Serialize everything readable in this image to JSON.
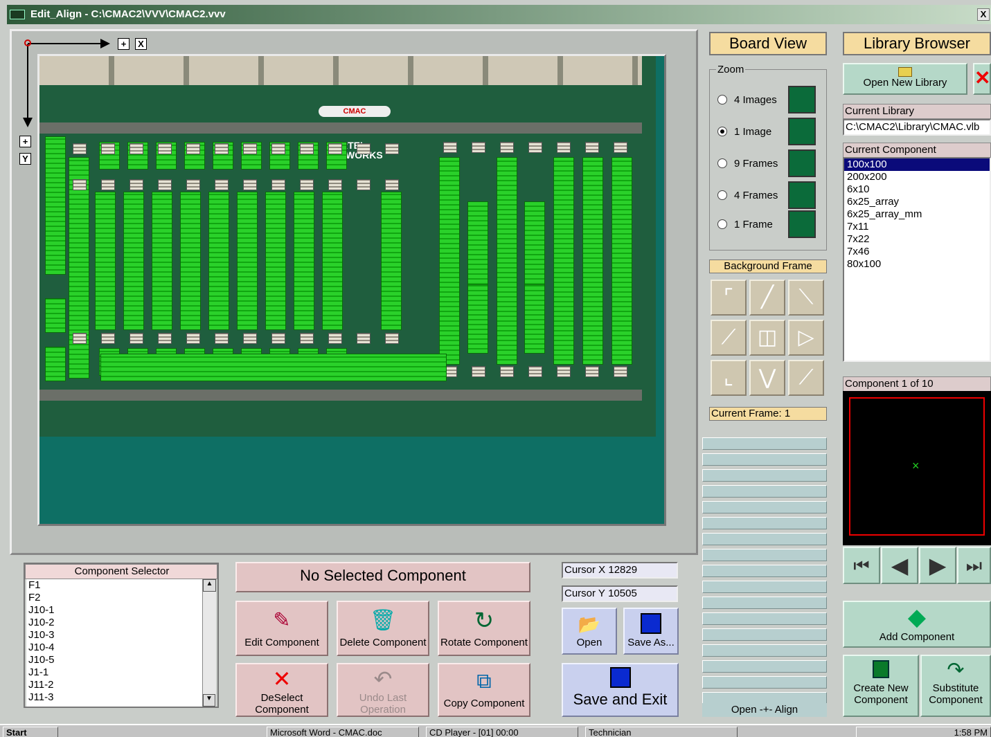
{
  "window": {
    "title": "Edit_Align - C:\\CMAC2\\VVV\\CMAC2.vvv",
    "close_label": "X"
  },
  "canvas": {
    "x_axis_label": "X",
    "y_axis_label": "Y",
    "plus": "+",
    "board_brand": "NORTEL NETWORKS",
    "board_logo": "CMAC"
  },
  "board_view": {
    "title": "Board View",
    "zoom_label": "Zoom",
    "options": [
      "4 Images",
      "1 Image",
      "9 Frames",
      "4 Frames",
      "1 Frame"
    ],
    "selected": "1 Image",
    "background_frame_label": "Background Frame",
    "current_frame": "Current Frame: 1",
    "open_align_label": "Open -+- Align"
  },
  "library": {
    "title": "Library Browser",
    "open_button": "Open New Library",
    "current_library_label": "Current Library",
    "current_library_value": "C:\\CMAC2\\Library\\CMAC.vlb",
    "current_component_label": "Current Component",
    "components": [
      "100x100",
      "200x200",
      "6x10",
      "6x25_array",
      "6x25_array_mm",
      "7x11",
      "7x22",
      "7x46",
      "80x100"
    ],
    "selected_component": "100x100",
    "counter": "Component 1 of 10",
    "add_button": "Add Component",
    "create_button_l1": "Create New",
    "create_button_l2": "Component",
    "substitute_button_l1": "Substitute",
    "substitute_button_l2": "Component"
  },
  "component_selector": {
    "title": "Component Selector",
    "items": [
      "F1",
      "F2",
      "J10-1",
      "J10-2",
      "J10-3",
      "J10-4",
      "J10-5",
      "J1-1",
      "J11-2",
      "J11-3"
    ]
  },
  "actions": {
    "status": "No Selected Component",
    "edit": "Edit Component",
    "delete": "Delete Component",
    "rotate": "Rotate Component",
    "deselect_l1": "DeSelect",
    "deselect_l2": "Component",
    "undo_l1": "Undo Last",
    "undo_l2": "Operation",
    "copy": "Copy Component"
  },
  "cursor": {
    "x_label": "Cursor X",
    "x_value": "12829",
    "y_label": "Cursor Y",
    "y_value": "10505"
  },
  "file": {
    "open": "Open",
    "save_as": "Save As...",
    "save_exit": "Save and Exit"
  },
  "taskbar": {
    "start": "Start",
    "items": [
      "Microsoft Word - CMAC.doc",
      "CD Player - [01] 00:00",
      "Technician"
    ],
    "clock": "1:58 PM"
  },
  "colors": {
    "canvas_bg": "#0e6f64",
    "header_tan": "#f5dca0",
    "button_pink": "#e2c4c4",
    "button_green": "#b5d8c8",
    "button_blue": "#c9d0ee",
    "selection": "#0a0a7a"
  }
}
